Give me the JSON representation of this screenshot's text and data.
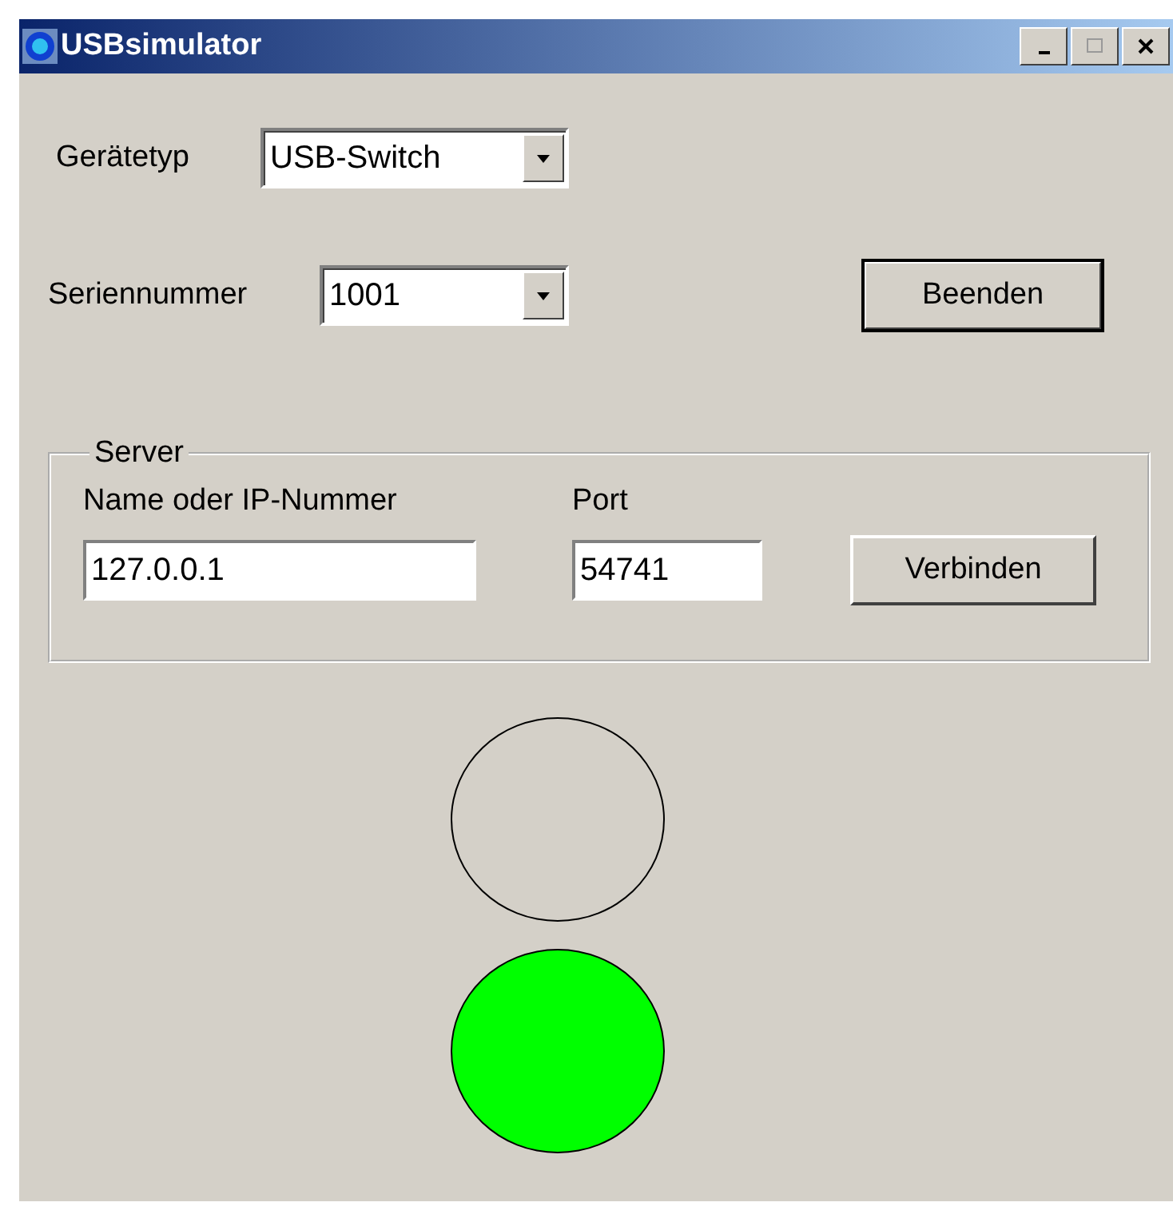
{
  "window": {
    "title": "USBsimulator"
  },
  "device_type": {
    "label": "Gerätetyp",
    "value": "USB-Switch"
  },
  "serial_number": {
    "label": "Seriennummer",
    "value": "1001"
  },
  "exit_button": {
    "label": "Beenden",
    "default": true
  },
  "server": {
    "legend": "Server",
    "host_label": "Name oder IP-Nummer",
    "host": "127.0.0.1",
    "port_label": "Port",
    "port": "54741",
    "connect_button": "Verbinden"
  },
  "lights": [
    {
      "on": false
    },
    {
      "on": true
    }
  ]
}
